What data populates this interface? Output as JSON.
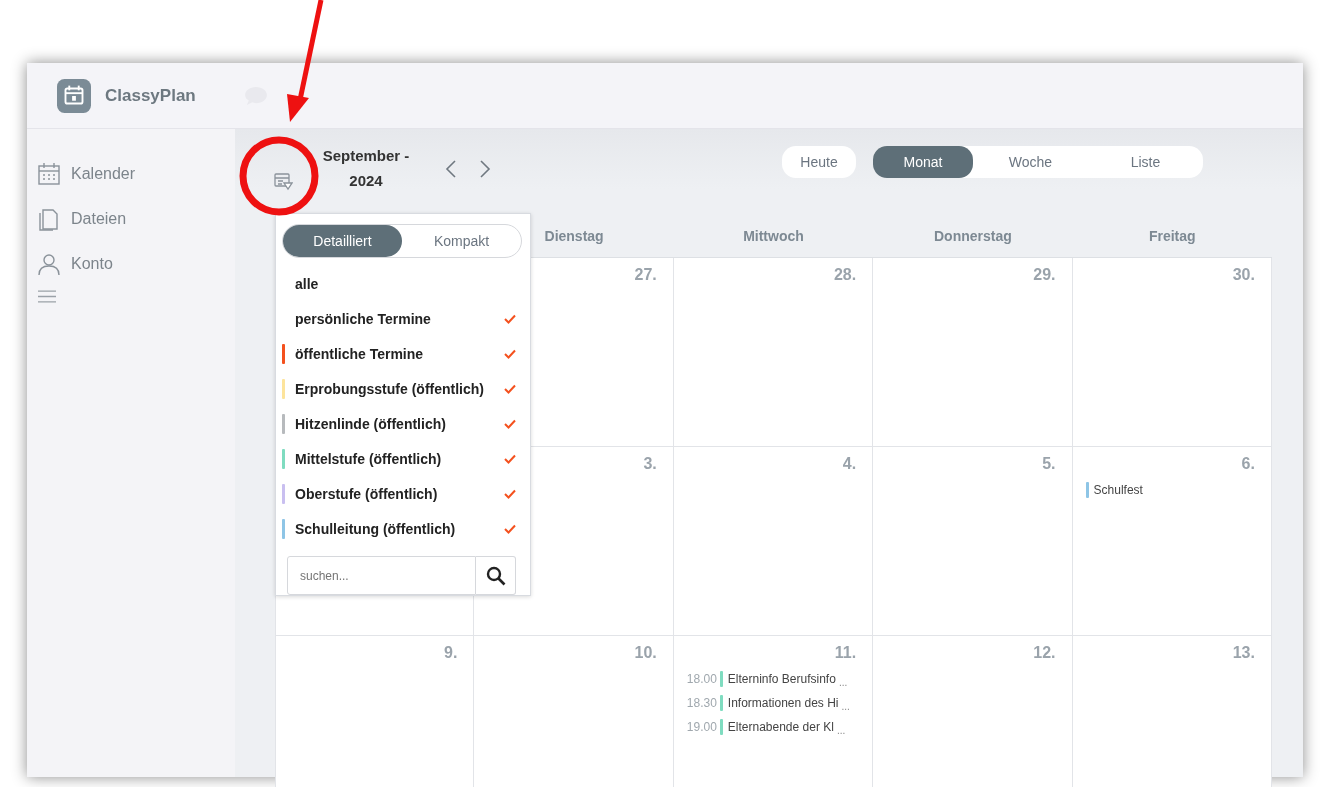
{
  "app": {
    "name": "ClassyPlan"
  },
  "sidebar": {
    "items": [
      {
        "label": "Kalender"
      },
      {
        "label": "Dateien"
      },
      {
        "label": "Konto"
      }
    ]
  },
  "toolbar": {
    "title_line1": "September -",
    "title_line2": "2024",
    "today": "Heute",
    "views": [
      {
        "label": "Monat",
        "selected": true
      },
      {
        "label": "Woche",
        "selected": false
      },
      {
        "label": "Liste",
        "selected": false
      }
    ]
  },
  "weekdays": [
    "Dienstag",
    "Mittwoch",
    "Donnerstag",
    "Freitag"
  ],
  "weeks": [
    {
      "cells": [
        {
          "day": "27."
        },
        {
          "day": "28."
        },
        {
          "day": "29."
        },
        {
          "day": "30."
        }
      ]
    },
    {
      "cells": [
        {
          "day": "3."
        },
        {
          "day": "4."
        },
        {
          "day": "5."
        },
        {
          "day": "6.",
          "events": [
            {
              "title": "Schulfest",
              "color": "#8ec5e6"
            }
          ]
        }
      ]
    },
    {
      "cells": [
        {
          "day": "9."
        },
        {
          "day": "10."
        },
        {
          "day": "11.",
          "events": [
            {
              "time": "18.00",
              "title": "Elterninfo Berufsinfo",
              "more": "...",
              "color": "#7fdcc0"
            },
            {
              "time": "18.30",
              "title": "Informationen des Hi",
              "more": "...",
              "color": "#7fdcc0"
            },
            {
              "time": "19.00",
              "title": "Elternabende der Kl",
              "more": "...",
              "color": "#7fdcc0"
            }
          ]
        },
        {
          "day": "12."
        },
        {
          "day": "13."
        }
      ]
    }
  ],
  "filter_popup": {
    "modes": [
      {
        "label": "Detailliert",
        "selected": true
      },
      {
        "label": "Kompakt",
        "selected": false
      }
    ],
    "items": [
      {
        "label": "alle",
        "checked": false
      },
      {
        "label": "persönliche Termine",
        "checked": true
      },
      {
        "label": "öffentliche Termine",
        "checked": true,
        "color": "#f4511e"
      },
      {
        "label": "Erprobungsstufe (öffentlich)",
        "checked": true,
        "color": "#fde49c"
      },
      {
        "label": "Hitzenlinde (öffentlich)",
        "checked": true,
        "color": "#b7babd"
      },
      {
        "label": "Mittelstufe (öffentlich)",
        "checked": true,
        "color": "#7fdcc0"
      },
      {
        "label": "Oberstufe (öffentlich)",
        "checked": true,
        "color": "#c9bff0"
      },
      {
        "label": "Schulleitung (öffentlich)",
        "checked": true,
        "color": "#8ec5e6"
      }
    ],
    "search": {
      "placeholder": "suchen..."
    }
  }
}
